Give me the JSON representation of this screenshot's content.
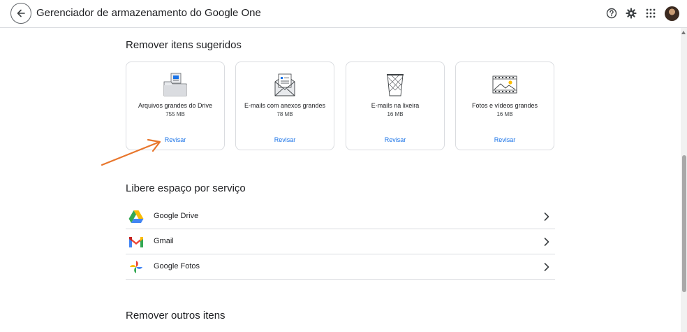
{
  "header": {
    "title": "Gerenciador de armazenamento do Google One"
  },
  "suggested": {
    "title": "Remover itens sugeridos",
    "cards": [
      {
        "title": "Arquivos grandes do Drive",
        "size": "755 MB",
        "action": "Revisar"
      },
      {
        "title": "E-mails com anexos grandes",
        "size": "78 MB",
        "action": "Revisar"
      },
      {
        "title": "E-mails na lixeira",
        "size": "16 MB",
        "action": "Revisar"
      },
      {
        "title": "Fotos e vídeos grandes",
        "size": "16 MB",
        "action": "Revisar"
      }
    ]
  },
  "services": {
    "title": "Libere espaço por serviço",
    "items": [
      {
        "name": "Google Drive"
      },
      {
        "name": "Gmail"
      },
      {
        "name": "Google Fotos"
      }
    ]
  },
  "other": {
    "title": "Remover outros itens"
  },
  "colors": {
    "accent": "#1a73e8",
    "annotation_arrow": "#e8762c"
  }
}
